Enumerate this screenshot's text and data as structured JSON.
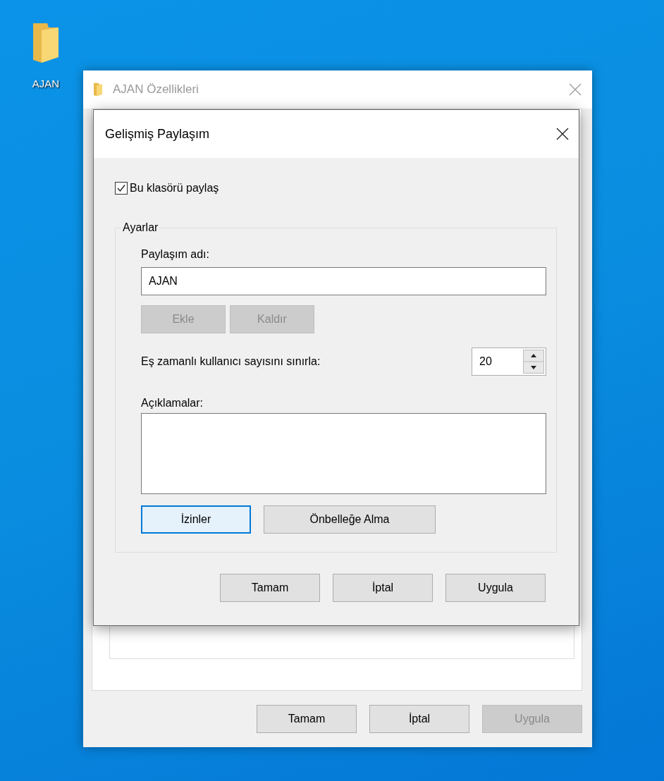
{
  "desktop_icon": {
    "label": "AJAN"
  },
  "properties_window": {
    "title": "AJAN Özellikleri",
    "active": false,
    "buttons": [
      {
        "label": "Tamam",
        "disabled": false
      },
      {
        "label": "İptal",
        "disabled": false
      },
      {
        "label": "Uygula",
        "disabled": true
      }
    ]
  },
  "dialog": {
    "title": "Gelişmiş Paylaşım",
    "share_checkbox": {
      "label": "Bu klasörü paylaş",
      "checked": true
    },
    "group": {
      "title": "Ayarlar",
      "share_name_label": "Paylaşım adı:",
      "share_name": {
        "value": "AJAN"
      },
      "name_buttons": [
        {
          "label": "Ekle",
          "disabled": true
        },
        {
          "label": "Kaldır",
          "disabled": true
        }
      ],
      "limit_label": "Eş zamanlı kullanıcı sayısını sınırla:",
      "limit": {
        "value": "20"
      },
      "comments_label": "Açıklamalar:",
      "buttons": [
        {
          "label": "İzinler",
          "focused": true
        },
        {
          "label": "Önbelleğe Alma",
          "focused": false
        }
      ]
    },
    "buttons": [
      {
        "label": "Tamam",
        "disabled": false
      },
      {
        "label": "İptal",
        "disabled": false
      },
      {
        "label": "Uygula",
        "disabled": false
      }
    ]
  }
}
